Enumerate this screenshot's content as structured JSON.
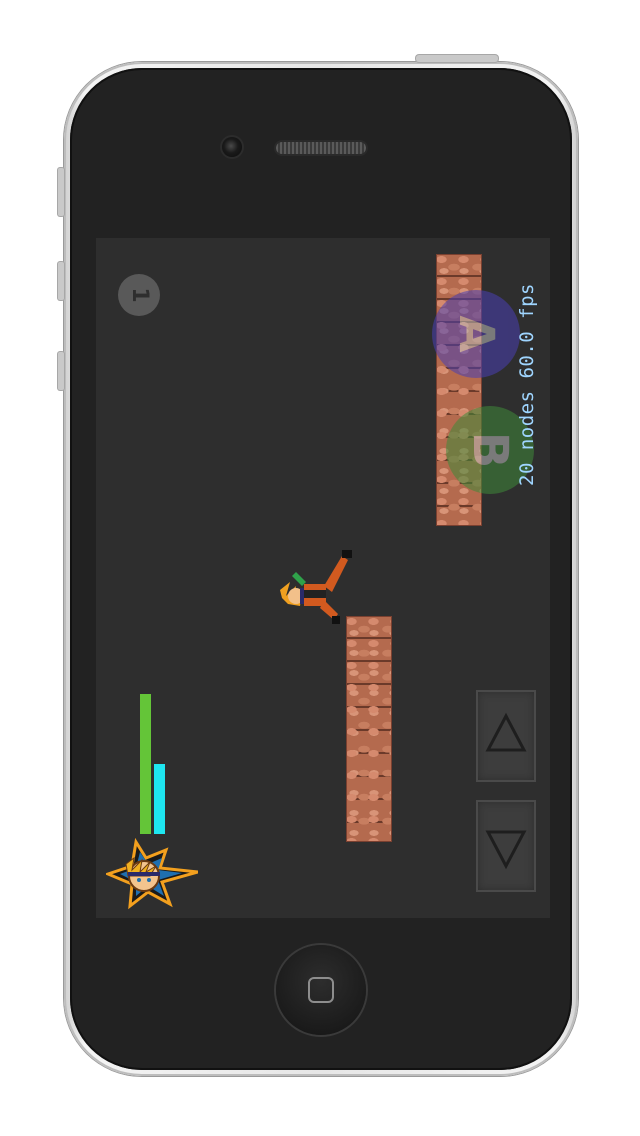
{
  "hud": {
    "stats_text": "20 nodes 60.0 fps",
    "pause_label": "1",
    "action_a_label": "A",
    "action_b_label": "B",
    "health_level": 1.0,
    "chakra_level": 0.5
  },
  "icons": {
    "up": "triangle-up-icon",
    "down": "triangle-down-icon",
    "character": "ninja-character-portrait",
    "home": "home-button-icon"
  },
  "colors": {
    "background": "#2e2e2e",
    "health": "#64c538",
    "chakra": "#1ee6f0",
    "stats_text": "#9fd5ff",
    "action_a": "#4a3fb3",
    "action_b": "#3f8a3a",
    "brick": "#b46a4e"
  }
}
